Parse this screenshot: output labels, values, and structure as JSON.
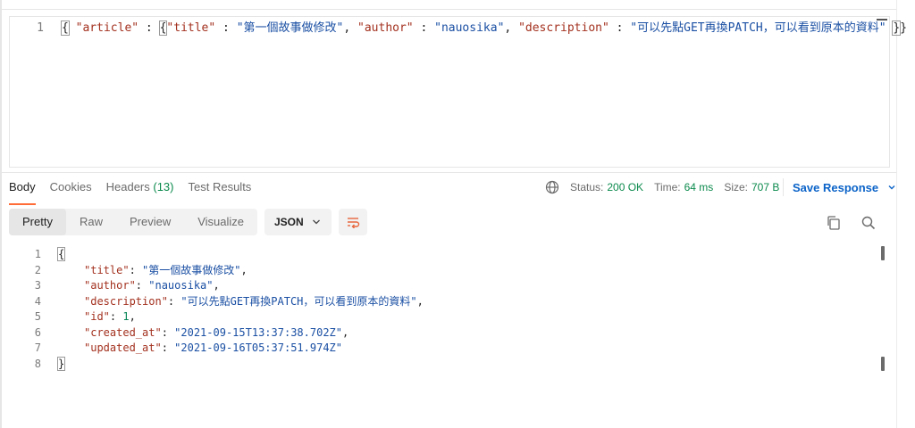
{
  "request": {
    "line_number": "1",
    "body_tokens": {
      "open": "{",
      "article_key": "\"article\"",
      "colon": " : ",
      "inner_open": "{",
      "title_key": "\"title\"",
      "title_val": "\"第一個故事做修改\"",
      "comma": ", ",
      "author_key": "\"author\"",
      "author_val": "\"nauosika\"",
      "description_key": "\"description\"",
      "description_val": "\"可以先點GET再換PATCH，可以看到原本的資料\"",
      "inner_close": "}",
      "close": "}"
    }
  },
  "response_tabs": [
    {
      "label": "Body"
    },
    {
      "label": "Cookies"
    },
    {
      "label": "Headers",
      "count": "(13)"
    },
    {
      "label": "Test Results"
    }
  ],
  "status": {
    "status_label": "Status:",
    "status_value": "200 OK",
    "time_label": "Time:",
    "time_value": "64 ms",
    "size_label": "Size:",
    "size_value": "707 B",
    "save_label": "Save Response"
  },
  "view_modes": [
    "Pretty",
    "Raw",
    "Preview",
    "Visualize"
  ],
  "format": "JSON",
  "icons": {
    "globe": "globe-icon",
    "wrap": "wrap-lines-icon",
    "copy": "copy-icon",
    "search": "search-icon",
    "chevron": "chevron-down-icon"
  },
  "colors": {
    "accent": "#ff6c37",
    "save": "#0b63c8",
    "success": "#0c8a4d",
    "json_key": "#a3311f",
    "json_string": "#1a4fa3",
    "json_number": "#098658"
  },
  "response_body": {
    "lines": [
      {
        "num": "1",
        "open": "{"
      },
      {
        "num": "2",
        "key": "\"title\"",
        "value": "\"第一個故事做修改\"",
        "trail": ","
      },
      {
        "num": "3",
        "key": "\"author\"",
        "value": "\"nauosika\"",
        "trail": ","
      },
      {
        "num": "4",
        "key": "\"description\"",
        "value": "\"可以先點GET再換PATCH，可以看到原本的資料\"",
        "trail": ","
      },
      {
        "num": "5",
        "key": "\"id\"",
        "value": "1",
        "trail": ","
      },
      {
        "num": "6",
        "key": "\"created_at\"",
        "value": "\"2021-09-15T13:37:38.702Z\"",
        "trail": ","
      },
      {
        "num": "7",
        "key": "\"updated_at\"",
        "value": "\"2021-09-16T05:37:51.974Z\"",
        "trail": ""
      },
      {
        "num": "8",
        "close": "}"
      }
    ]
  }
}
